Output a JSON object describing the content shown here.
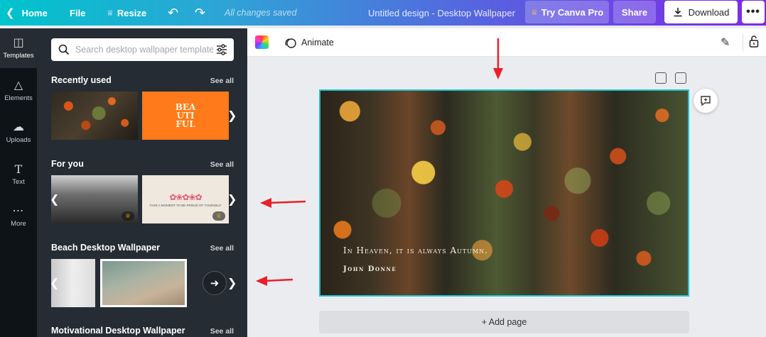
{
  "topbar": {
    "home_label": "Home",
    "file_label": "File",
    "resize_label": "Resize",
    "status": "All changes saved",
    "document_title": "Untitled design - Desktop Wallpaper",
    "try_pro_label": "Try Canva Pro",
    "share_label": "Share",
    "download_label": "Download",
    "more_label": "•••"
  },
  "rail": {
    "items": [
      {
        "label": "Templates",
        "icon": "templates-icon"
      },
      {
        "label": "Elements",
        "icon": "elements-icon"
      },
      {
        "label": "Uploads",
        "icon": "uploads-icon"
      },
      {
        "label": "Text",
        "icon": "text-icon"
      },
      {
        "label": "More",
        "icon": "more-icon"
      }
    ],
    "active": "Templates"
  },
  "panel": {
    "search_placeholder": "Search desktop wallpaper templates",
    "sections": [
      {
        "title": "Recently used",
        "see_all": "See all"
      },
      {
        "title": "For you",
        "see_all": "See all"
      },
      {
        "title": "Beach Desktop Wallpaper",
        "see_all": "See all"
      },
      {
        "title": "Motivational Desktop Wallpaper",
        "see_all": "See all"
      }
    ],
    "thumb_text": {
      "orange_template": "BEA\nUTI\nFUL",
      "floral_template": "TAKE A MOMENT TO BE PROUD OF YOURSELF"
    }
  },
  "toolbar": {
    "animate_label": "Animate"
  },
  "canvas": {
    "quote": "In Heaven, it is always Autumn.",
    "author": "John Donne",
    "add_page_label": "+ Add page"
  },
  "colors": {
    "accent": "#7d2ae8",
    "selection_border": "#1fc4d3",
    "annotation_arrow": "#e8202a",
    "panel_bg": "#252c33"
  }
}
